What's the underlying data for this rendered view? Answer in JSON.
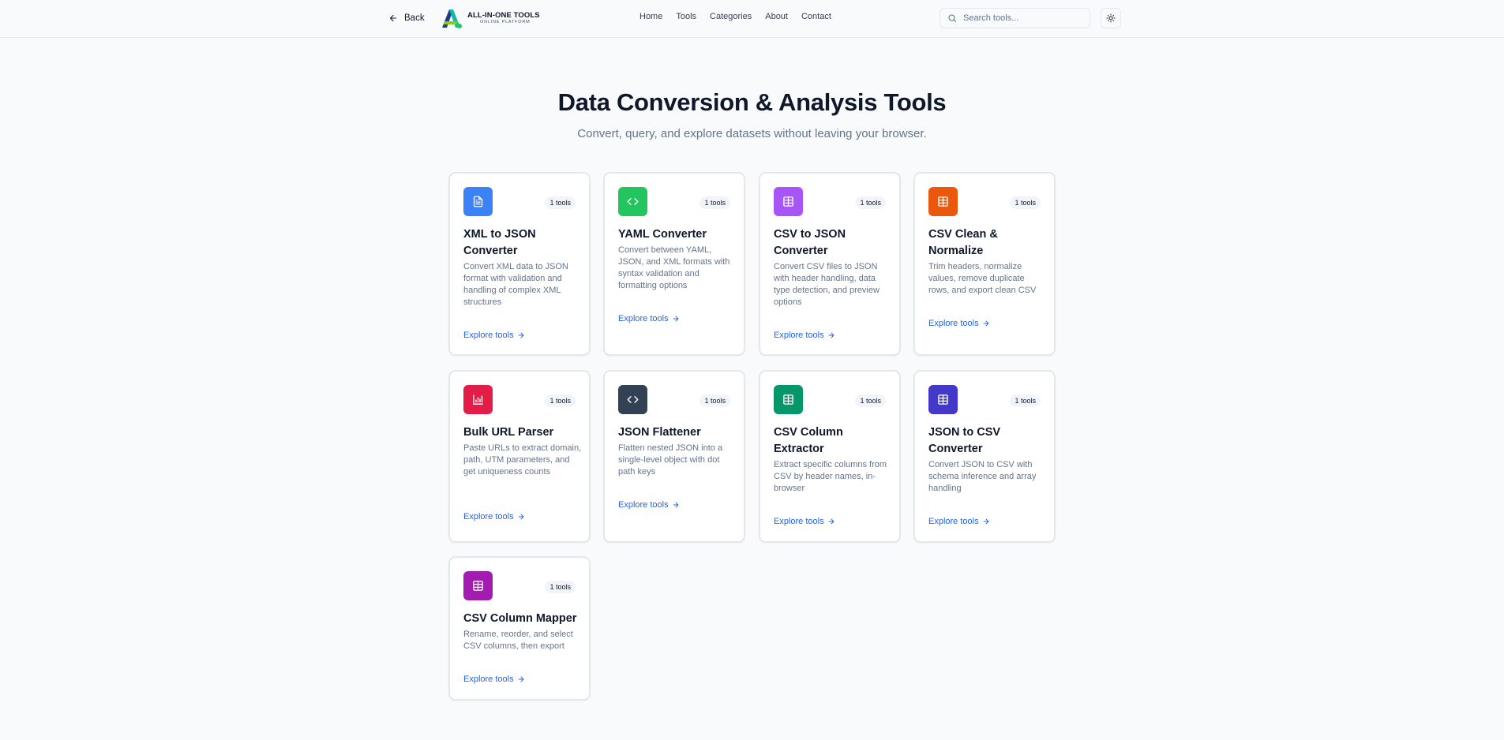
{
  "header": {
    "back_label": "Back",
    "logo_title": "ALL-IN-ONE TOOLS",
    "logo_subtitle": "ONLINE PLATFORM",
    "nav": [
      "Home",
      "Tools",
      "Categories",
      "About",
      "Contact"
    ],
    "search_placeholder": "Search tools..."
  },
  "hero": {
    "title": "Data Conversion & Analysis Tools",
    "subtitle": "Convert, query, and explore datasets without leaving your browser."
  },
  "cards": [
    {
      "title": "XML to JSON Converter",
      "badge": "1 tools",
      "description": "Convert XML data to JSON format with validation and handling of complex XML structures",
      "link": "Explore tools",
      "icon": "file-text-icon",
      "color": "#3b82f6"
    },
    {
      "title": "YAML Converter",
      "badge": "1 tools",
      "description": "Convert between YAML, JSON, and XML formats with syntax validation and formatting options",
      "link": "Explore tools",
      "icon": "code-icon",
      "color": "#22c55e"
    },
    {
      "title": "CSV to JSON Converter",
      "badge": "1 tools",
      "description": "Convert CSV files to JSON with header handling, data type detection, and preview options",
      "link": "Explore tools",
      "icon": "table-icon",
      "color": "#a855f7"
    },
    {
      "title": "CSV Clean & Normalize",
      "badge": "1 tools",
      "description": "Trim headers, normalize values, remove duplicate rows, and export clean CSV",
      "link": "Explore tools",
      "icon": "table-icon",
      "color": "#ea580c"
    },
    {
      "title": "Bulk URL Parser",
      "badge": "1 tools",
      "description": "Paste URLs to extract domain, path, UTM parameters, and get uniqueness counts",
      "link": "Explore tools",
      "icon": "bar-chart-icon",
      "color": "#e11d48"
    },
    {
      "title": "JSON Flattener",
      "badge": "1 tools",
      "description": "Flatten nested JSON into a single-level object with dot path keys",
      "link": "Explore tools",
      "icon": "code-icon",
      "color": "#334155"
    },
    {
      "title": "CSV Column Extractor",
      "badge": "1 tools",
      "description": "Extract specific columns from CSV by header names, in-browser",
      "link": "Explore tools",
      "icon": "table-icon",
      "color": "#059669"
    },
    {
      "title": "JSON to CSV Converter",
      "badge": "1 tools",
      "description": "Convert JSON to CSV with schema inference and array handling",
      "link": "Explore tools",
      "icon": "table-icon",
      "color": "#4338ca"
    },
    {
      "title": "CSV Column Mapper",
      "badge": "1 tools",
      "description": "Rename, reorder, and select CSV columns, then export",
      "link": "Explore tools",
      "icon": "table-icon",
      "color": "#a21caf"
    }
  ]
}
